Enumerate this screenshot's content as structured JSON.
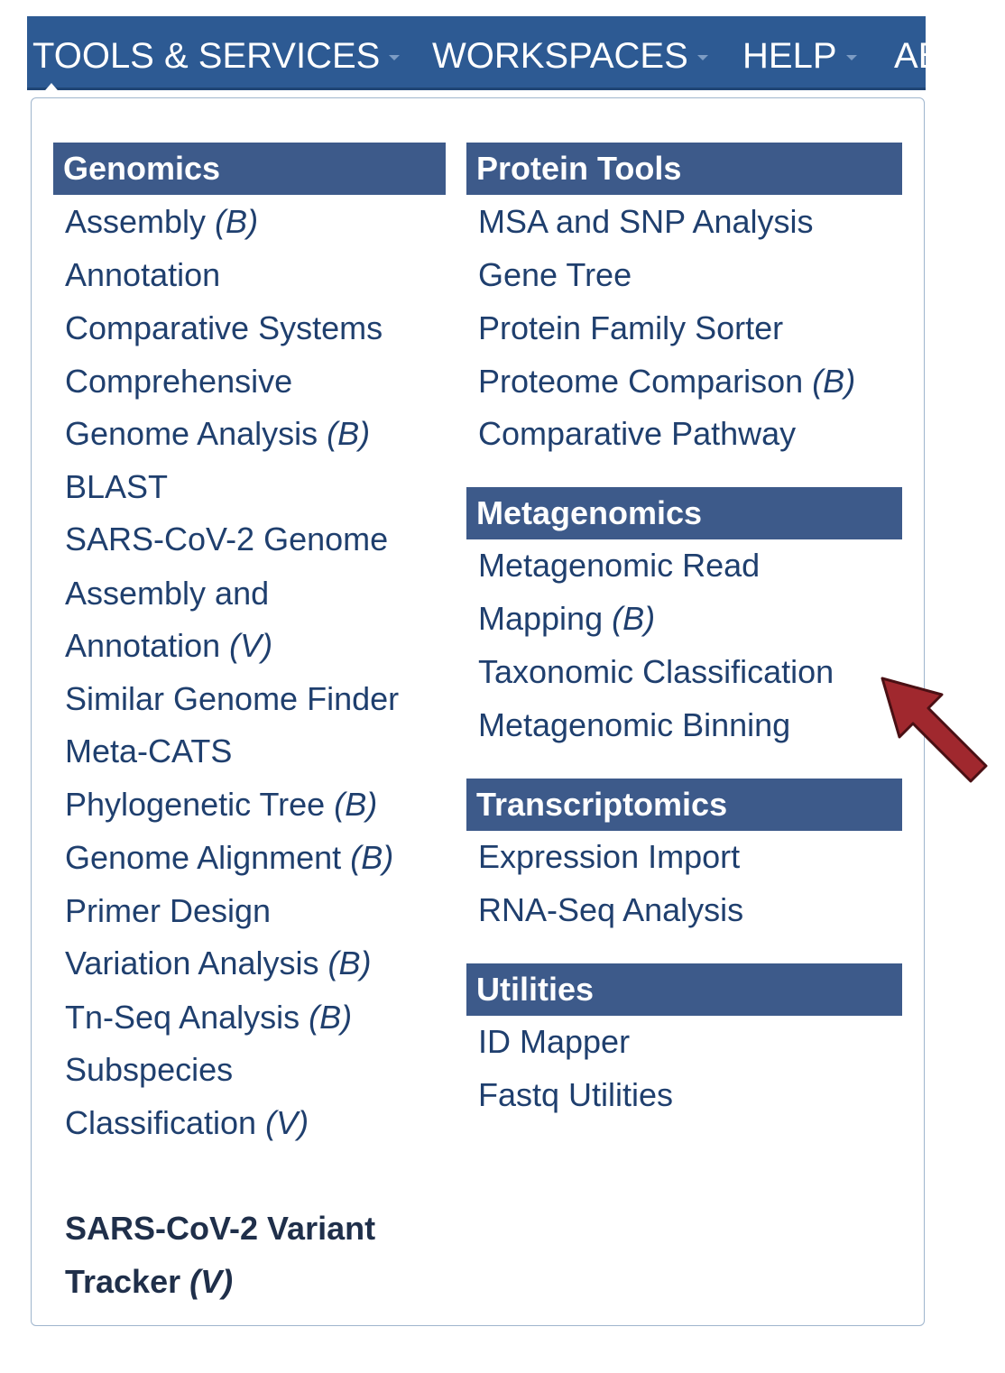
{
  "nav": {
    "items": [
      {
        "label": "TOOLS & SERVICES"
      },
      {
        "label": "WORKSPACES"
      },
      {
        "label": "HELP"
      },
      {
        "label": "AB"
      }
    ]
  },
  "genomics": {
    "header": "Genomics",
    "assembly": {
      "text": "Assembly",
      "tag": "(B)"
    },
    "annotation": {
      "text": "Annotation"
    },
    "comparative_systems": {
      "text": "Comparative Systems"
    },
    "comprehensive": {
      "line1": "Comprehensive",
      "line2": "Genome Analysis",
      "tag": "(B)"
    },
    "blast": {
      "text": "BLAST"
    },
    "sars_assembly": {
      "line1": "SARS-CoV-2 Genome",
      "line2": "Assembly and",
      "line3": "Annotation",
      "tag": "(V)"
    },
    "similar_genome": {
      "text": "Similar Genome Finder"
    },
    "meta_cats": {
      "text": "Meta-CATS"
    },
    "phylogenetic_tree": {
      "text": "Phylogenetic Tree",
      "tag": "(B)"
    },
    "genome_alignment": {
      "text": "Genome Alignment",
      "tag": "(B)"
    },
    "primer_design": {
      "text": "Primer Design"
    },
    "variation_analysis": {
      "text": "Variation Analysis",
      "tag": "(B)"
    },
    "tn_seq": {
      "text": "Tn-Seq Analysis",
      "tag": "(B)"
    },
    "subspecies": {
      "line1": "Subspecies",
      "line2": "Classification",
      "tag": "(V)"
    },
    "variant_tracker": {
      "line1": "SARS-CoV-2 Variant",
      "line2": "Tracker",
      "tag": "(V)"
    }
  },
  "protein_tools": {
    "header": "Protein Tools",
    "msa": {
      "text": "MSA and SNP Analysis"
    },
    "gene_tree": {
      "text": "Gene Tree"
    },
    "family_sorter": {
      "text": "Protein Family Sorter"
    },
    "proteome": {
      "text": "Proteome Comparison",
      "tag": "(B)"
    },
    "pathway": {
      "text": "Comparative Pathway"
    }
  },
  "metagenomics": {
    "header": "Metagenomics",
    "read_mapping": {
      "line1": "Metagenomic Read",
      "line2": "Mapping",
      "tag": "(B)"
    },
    "taxonomic": {
      "text": "Taxonomic Classification"
    },
    "binning": {
      "text": "Metagenomic Binning"
    }
  },
  "transcriptomics": {
    "header": "Transcriptomics",
    "expression_import": {
      "text": "Expression Import"
    },
    "rnaseq": {
      "text": "RNA-Seq Analysis"
    }
  },
  "utilities": {
    "header": "Utilities",
    "id_mapper": {
      "text": "ID Mapper"
    },
    "fastq": {
      "text": "Fastq Utilities"
    }
  },
  "colors": {
    "navbar": "#2d5a93",
    "section_header": "#3d5a8a",
    "link_text": "#1f3f6e",
    "annotation_arrow": "#a0282e"
  },
  "icons": {
    "dropdown_caret": "chevron-down-icon",
    "annotation": "arrow-icon"
  }
}
